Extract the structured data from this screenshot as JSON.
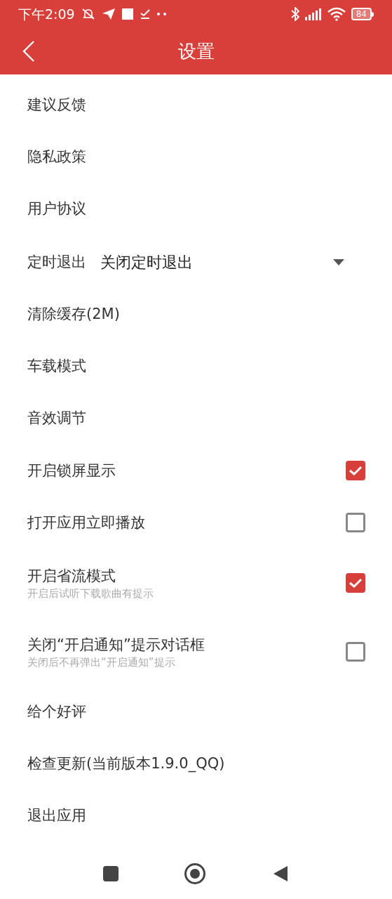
{
  "status_bar": {
    "time": "下午2:09",
    "battery": "84"
  },
  "toolbar": {
    "title": "设置"
  },
  "items": [
    {
      "kind": "link",
      "label": "建议反馈"
    },
    {
      "kind": "link",
      "label": "隐私政策"
    },
    {
      "kind": "link",
      "label": "用户协议"
    },
    {
      "kind": "dropdown",
      "label": "定时退出",
      "value": "关闭定时退出"
    },
    {
      "kind": "link",
      "label": "清除缓存(2M)"
    },
    {
      "kind": "link",
      "label": "车载模式"
    },
    {
      "kind": "link",
      "label": "音效调节"
    },
    {
      "kind": "checkbox",
      "label": "开启锁屏显示",
      "checked": true
    },
    {
      "kind": "checkbox",
      "label": "打开应用立即播放",
      "checked": false
    },
    {
      "kind": "checkbox",
      "label": "开启省流模式",
      "subtitle": "开启后试听下载歌曲有提示",
      "checked": true
    },
    {
      "kind": "checkbox",
      "label": "关闭“开启通知”提示对话框",
      "subtitle": "关闭后不再弹出“开启通知”提示",
      "checked": false
    },
    {
      "kind": "link",
      "label": "给个好评"
    },
    {
      "kind": "link",
      "label": "检查更新(当前版本1.9.0_QQ)"
    },
    {
      "kind": "link",
      "label": "退出应用"
    }
  ]
}
